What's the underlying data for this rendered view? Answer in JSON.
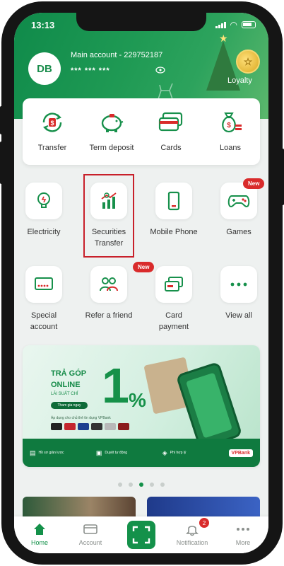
{
  "status_bar": {
    "time": "13:13"
  },
  "header": {
    "avatar_initials": "DB",
    "account_title": "Main account - 229752187",
    "balance_masked": "*** *** ***",
    "loyalty_label": "Loyalty"
  },
  "quick_actions": [
    {
      "label": "Transfer",
      "icon": "money-transfer-icon"
    },
    {
      "label": "Term deposit",
      "icon": "piggy-bank-icon"
    },
    {
      "label": "Cards",
      "icon": "cards-icon"
    },
    {
      "label": "Loans",
      "icon": "money-bag-icon"
    }
  ],
  "services": [
    {
      "label_1": "Electricity",
      "label_2": "",
      "icon": "lightbulb-icon"
    },
    {
      "label_1": "Securities",
      "label_2": "Transfer",
      "icon": "securities-chart-icon"
    },
    {
      "label_1": "Mobile Phone",
      "label_2": "",
      "icon": "mobile-phone-icon"
    },
    {
      "label_1": "Games",
      "label_2": "",
      "icon": "gamepad-icon",
      "badge": "New"
    },
    {
      "label_1": "Special",
      "label_2": "account",
      "icon": "special-account-icon"
    },
    {
      "label_1": "Refer a friend",
      "label_2": "",
      "icon": "refer-friend-icon",
      "badge": "New"
    },
    {
      "label_1": "Card",
      "label_2": "payment",
      "icon": "card-payment-icon"
    },
    {
      "label_1": "View all",
      "label_2": "",
      "icon": "more-dots-icon"
    }
  ],
  "banner": {
    "line1": "TRẢ GÓP",
    "line2": "ONLINE",
    "line3": "LÃI SUẤT CHỈ",
    "rate_number": "1",
    "rate_unit": "%",
    "cta": "Tham gia ngay",
    "fine_print": "Áp dụng cho chủ thẻ tín dụng VPBank",
    "features": [
      "Hồ sơ giản lược",
      "Duyệt tự động",
      "Phí hợp lý"
    ],
    "logo": "VPBank"
  },
  "pagination": {
    "count": 5,
    "active_index": 2
  },
  "tabbar": {
    "home": "Home",
    "account": "Account",
    "notification": "Notification",
    "notification_count": "2",
    "more": "More"
  },
  "colors": {
    "brand_green": "#14914a",
    "badge_red": "#d92b2b",
    "highlight_red": "#c8202a"
  }
}
